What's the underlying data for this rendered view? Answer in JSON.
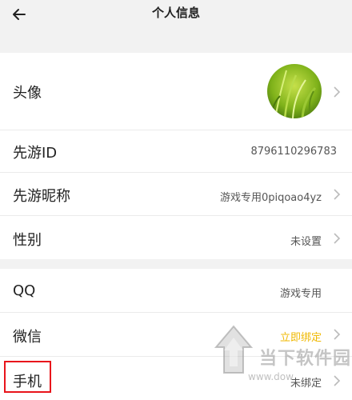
{
  "header": {
    "title": "个人信息",
    "back_icon": "back-arrow-icon"
  },
  "profile": {
    "avatar": {
      "label": "头像",
      "image": "green grass photo"
    },
    "id": {
      "label": "先游ID",
      "value": "8796110296783"
    },
    "nickname": {
      "label": "先游昵称",
      "value": "游戏专用0piqoao4yz"
    },
    "gender": {
      "label": "性别",
      "value": "未设置"
    }
  },
  "bindings": {
    "qq": {
      "label": "QQ",
      "value": "游戏专用"
    },
    "wechat": {
      "label": "微信",
      "value": "立即绑定",
      "value_color": "#f0b800"
    },
    "phone": {
      "label": "手机",
      "value": "未绑定"
    }
  },
  "highlight_color": "#e8141b",
  "watermark": {
    "name": "当下软件园",
    "url": "www.downxia.com",
    "url_visible": "www.dow"
  }
}
